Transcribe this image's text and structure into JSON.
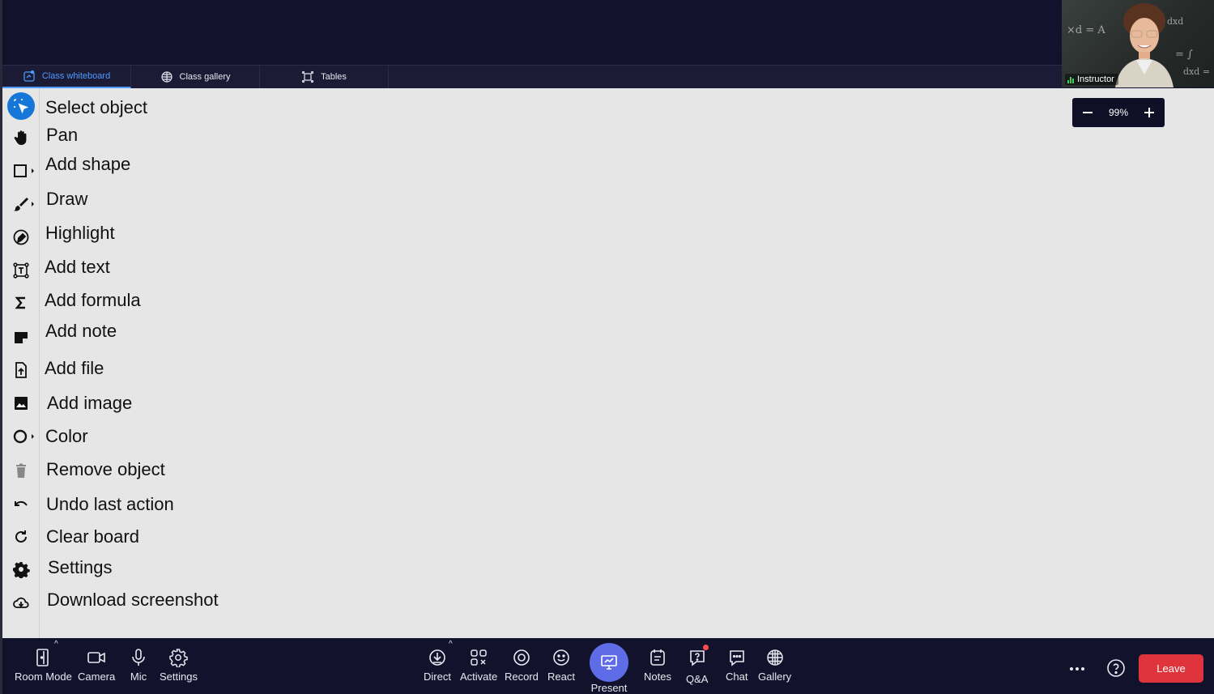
{
  "tabs": [
    {
      "label": "Class whiteboard",
      "active": true
    },
    {
      "label": "Class gallery",
      "active": false
    },
    {
      "label": "Tables",
      "active": false
    }
  ],
  "video": {
    "name": "Instructor"
  },
  "tools": [
    {
      "label": "Select object",
      "icon": "select-cursor-icon"
    },
    {
      "label": "Pan",
      "icon": "hand-icon"
    },
    {
      "label": "Add shape",
      "icon": "square-icon"
    },
    {
      "label": "Draw",
      "icon": "brush-icon"
    },
    {
      "label": "Highlight",
      "icon": "highlighter-icon"
    },
    {
      "label": "Add text",
      "icon": "text-box-icon"
    },
    {
      "label": "Add formula",
      "icon": "sigma-icon"
    },
    {
      "label": "Add note",
      "icon": "note-icon"
    },
    {
      "label": "Add file",
      "icon": "file-upload-icon"
    },
    {
      "label": "Add image",
      "icon": "image-icon"
    },
    {
      "label": "Color",
      "icon": "color-circle-icon"
    },
    {
      "label": "Remove object",
      "icon": "trash-icon"
    },
    {
      "label": "Undo last action",
      "icon": "undo-icon"
    },
    {
      "label": "Clear board",
      "icon": "refresh-icon"
    },
    {
      "label": "Settings",
      "icon": "gear-icon"
    },
    {
      "label": "Download screenshot",
      "icon": "cloud-download-icon"
    }
  ],
  "zoom": {
    "value": "99%"
  },
  "bottombar": {
    "room_mode": "Room Mode",
    "camera": "Camera",
    "mic": "Mic",
    "settings": "Settings",
    "direct": "Direct",
    "activate": "Activate",
    "record": "Record",
    "react": "React",
    "present": "Present",
    "notes": "Notes",
    "qa": "Q&A",
    "chat": "Chat",
    "gallery": "Gallery",
    "leave": "Leave"
  },
  "colors": {
    "accent": "#1677d9",
    "present": "#5e6ce8",
    "leave": "#e0343c",
    "background": "#12122c",
    "canvas": "#e6e6e6"
  }
}
